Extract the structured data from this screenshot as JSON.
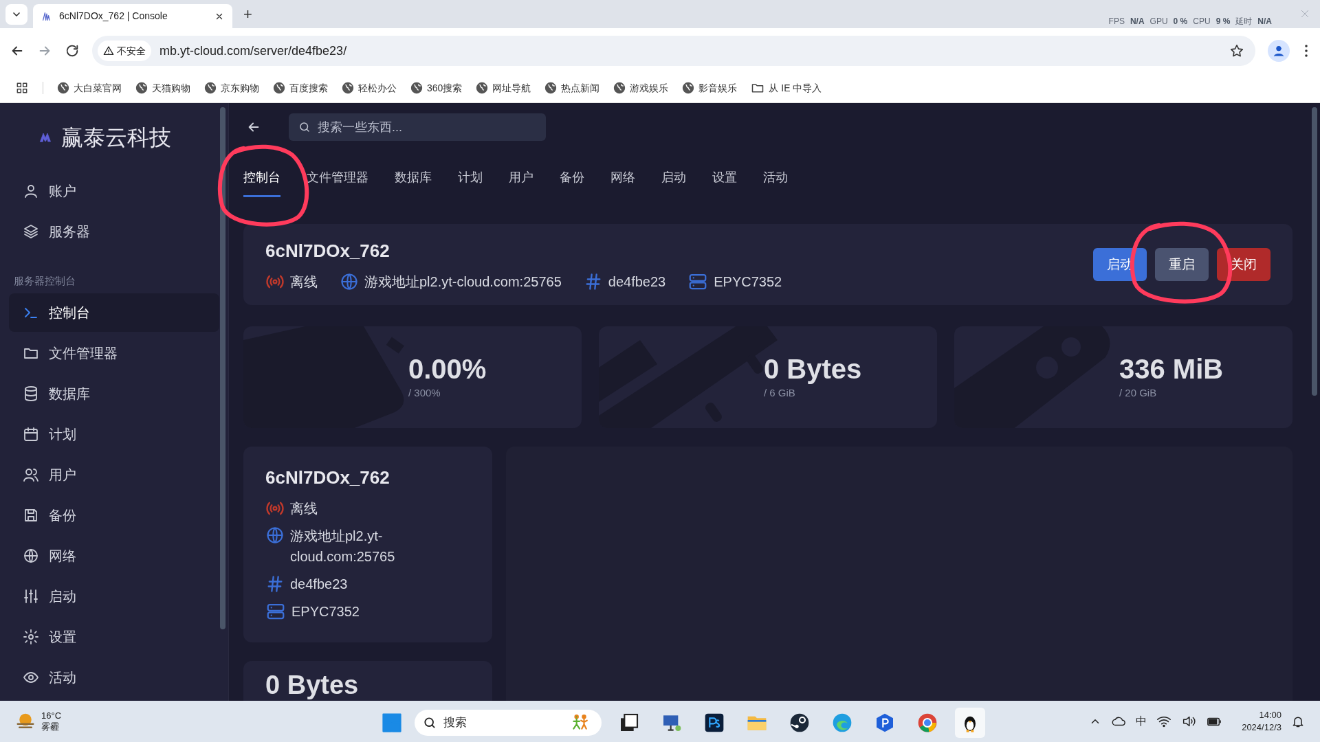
{
  "browser": {
    "tab_title": "6cNl7DOx_762 | Console",
    "new_tab": "+",
    "security": "不安全",
    "url": "mb.yt-cloud.com/server/de4fbe23/",
    "overlay": [
      "FPS",
      "N/A",
      "GPU",
      "0 %",
      "CPU",
      "9 %",
      "延时",
      "N/A"
    ],
    "bookmarks": [
      {
        "label": "大白菜官网",
        "kind": "site"
      },
      {
        "label": "天猫购物",
        "kind": "site"
      },
      {
        "label": "京东购物",
        "kind": "site"
      },
      {
        "label": "百度搜索",
        "kind": "site"
      },
      {
        "label": "轻松办公",
        "kind": "site"
      },
      {
        "label": "360搜索",
        "kind": "site"
      },
      {
        "label": "网址导航",
        "kind": "site"
      },
      {
        "label": "热点新闻",
        "kind": "site"
      },
      {
        "label": "游戏娱乐",
        "kind": "site"
      },
      {
        "label": "影音娱乐",
        "kind": "site"
      },
      {
        "label": "从 IE 中导入",
        "kind": "folder"
      }
    ]
  },
  "sidebar": {
    "brand": "赢泰云科技",
    "groups": [
      {
        "items": [
          {
            "label": "账户",
            "selected": false
          },
          {
            "label": "服务器",
            "selected": false
          }
        ]
      },
      {
        "title": "服务器控制台",
        "items": [
          {
            "label": "控制台",
            "selected": true
          },
          {
            "label": "文件管理器",
            "selected": false
          },
          {
            "label": "数据库",
            "selected": false
          },
          {
            "label": "计划",
            "selected": false
          },
          {
            "label": "用户",
            "selected": false
          },
          {
            "label": "备份",
            "selected": false
          },
          {
            "label": "网络",
            "selected": false
          },
          {
            "label": "启动",
            "selected": false
          },
          {
            "label": "设置",
            "selected": false
          },
          {
            "label": "活动",
            "selected": false
          }
        ]
      }
    ]
  },
  "search": {
    "placeholder": "搜索一些东西..."
  },
  "tabs": [
    {
      "label": "控制台",
      "selected": true
    },
    {
      "label": "文件管理器",
      "selected": false
    },
    {
      "label": "数据库",
      "selected": false
    },
    {
      "label": "计划",
      "selected": false
    },
    {
      "label": "用户",
      "selected": false
    },
    {
      "label": "备份",
      "selected": false
    },
    {
      "label": "网络",
      "selected": false
    },
    {
      "label": "启动",
      "selected": false
    },
    {
      "label": "设置",
      "selected": false
    },
    {
      "label": "活动",
      "selected": false
    }
  ],
  "server": {
    "name": "6cNl7DOx_762",
    "status": "离线",
    "address": "游戏地址pl2.yt-cloud.com:25765",
    "id": "de4fbe23",
    "cpu": "EPYC7352",
    "buttons": [
      {
        "label": "启动",
        "kind": "start"
      },
      {
        "label": "重启",
        "kind": "restart"
      },
      {
        "label": "关闭",
        "kind": "stop"
      }
    ]
  },
  "stats": [
    {
      "value": "0.00%",
      "limit": "/ 300%",
      "kind": "cpu"
    },
    {
      "value": "0 Bytes",
      "limit": "/ 6 GiB",
      "kind": "memory"
    },
    {
      "value": "336 MiB",
      "limit": "/ 20 GiB",
      "kind": "disk"
    }
  ],
  "info_card": {
    "name": "6cNl7DOx_762",
    "status": "离线",
    "address_lines": [
      "游戏地址pl2.yt-",
      "cloud.com:25765"
    ],
    "id": "de4fbe23",
    "cpu": "EPYC7352"
  },
  "lower_card": {
    "value": "0 Bytes"
  },
  "annotations": [
    {
      "kind": "circle"
    },
    {
      "kind": "circle"
    }
  ],
  "taskbar": {
    "temperature": "16°C",
    "weather": "雾霾",
    "search": "搜索",
    "ime": "中",
    "time": "14:00",
    "date": "2024/12/3"
  }
}
